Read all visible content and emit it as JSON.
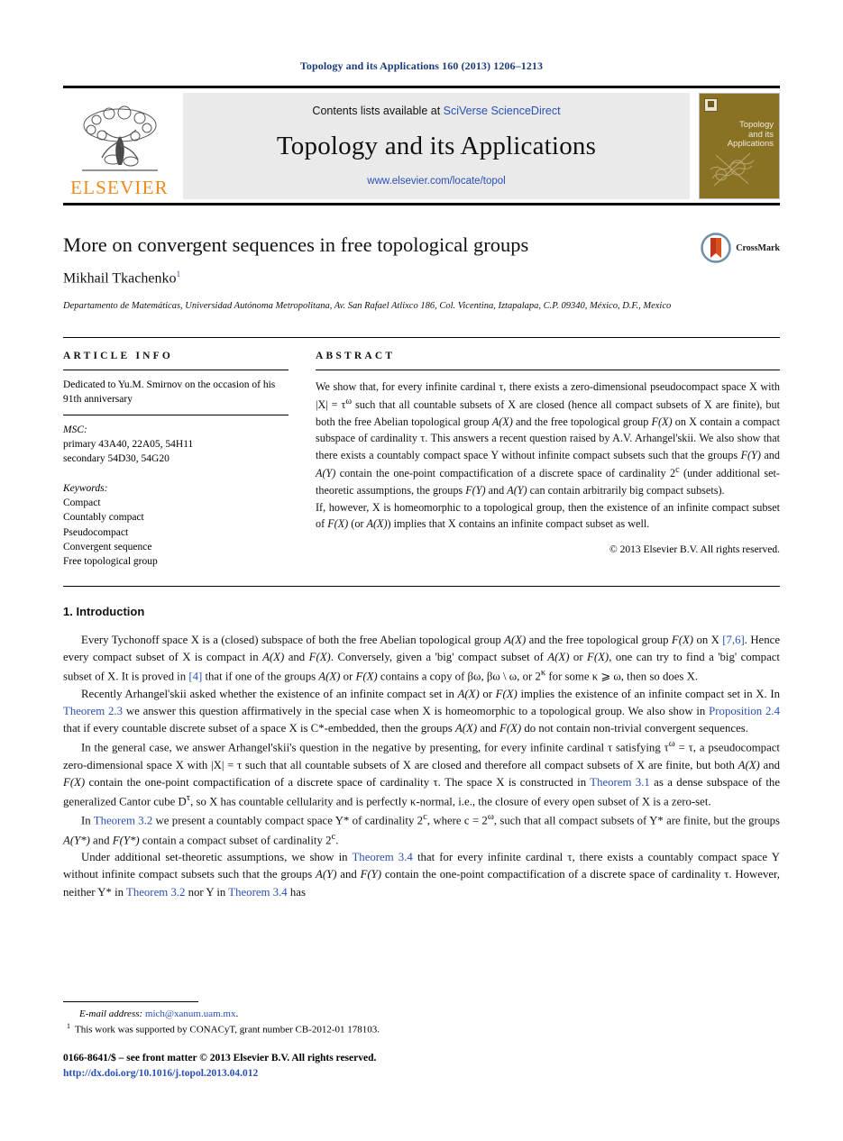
{
  "running_head": "Topology and its Applications 160 (2013) 1206–1213",
  "masthead": {
    "publisher_name": "ELSEVIER",
    "contents_prefix": "Contents lists available at ",
    "sciencedirect_link": "SciVerse ScienceDirect",
    "journal_title": "Topology and its Applications",
    "journal_url": "www.elsevier.com/locate/topol",
    "cover_title_lines": [
      "Topology",
      "and its",
      "Applications"
    ]
  },
  "title_block": {
    "title": "More on convergent sequences in free topological groups",
    "author": "Mikhail Tkachenko",
    "author_footnote_marker": "1",
    "affiliation": "Departamento de Matemáticas, Universidad Autónoma Metropolitana, Av. San Rafael Atlixco 186, Col. Vicentina, Iztapalapa, C.P. 09340, México, D.F., Mexico",
    "crossmark_label": "CrossMark"
  },
  "article_info": {
    "heading": "ARTICLE INFO",
    "dedication": "Dedicated to Yu.M. Smirnov on the occasion of his 91th anniversary",
    "msc_label": "MSC:",
    "msc_lines": [
      "primary 43A40, 22A05, 54H11",
      "secondary 54D30, 54G20"
    ],
    "keywords_label": "Keywords:",
    "keywords": [
      "Compact",
      "Countably compact",
      "Pseudocompact",
      "Convergent sequence",
      "Free topological group"
    ]
  },
  "abstract": {
    "heading": "ABSTRACT",
    "paragraphs": [
      "We show that, for every infinite cardinal τ, there exists a zero-dimensional pseudocompact space X with |X| = τ<sup>ω</sup> such that all countable subsets of X are closed (hence all compact subsets of X are finite), but both the free Abelian topological group A(X) and the free topological group F(X) on X contain a compact subspace of cardinality τ. This answers a recent question raised by A.V. Arhangel'skii. We also show that there exists a countably compact space Y without infinite compact subsets such that the groups F(Y) and A(Y) contain the one-point compactification of a discrete space of cardinality 2<sup>c</sup> (under additional set-theoretic assumptions, the groups F(Y) and A(Y) can contain arbitrarily big compact subsets).",
      "If, however, X is homeomorphic to a topological group, then the existence of an infinite compact subset of F(X) (or A(X)) implies that X contains an infinite compact subset as well."
    ],
    "copyright": "© 2013 Elsevier B.V. All rights reserved."
  },
  "section": {
    "number_title": "1. Introduction",
    "paragraphs": [
      "Every Tychonoff space X is a (closed) subspace of both the free Abelian topological group A(X) and the free topological group F(X) on X [7,6]. Hence every compact subset of X is compact in A(X) and F(X). Conversely, given a 'big' compact subset of A(X) or F(X), one can try to find a 'big' compact subset of X. It is proved in [4] that if one of the groups A(X) or F(X) contains a copy of βω, βω \\ ω, or 2<sup>κ</sup> for some κ ⩾ ω, then so does X.",
      "Recently Arhangel'skii asked whether the existence of an infinite compact set in A(X) or F(X) implies the existence of an infinite compact set in X. In Theorem 2.3 we answer this question affirmatively in the special case when X is homeomorphic to a topological group. We also show in Proposition 2.4 that if every countable discrete subset of a space X is C*-embedded, then the groups A(X) and F(X) do not contain non-trivial convergent sequences.",
      "In the general case, we answer Arhangel'skii's question in the negative by presenting, for every infinite cardinal τ satisfying τ<sup>ω</sup> = τ, a pseudocompact zero-dimensional space X with |X| = τ such that all countable subsets of X are closed and therefore all compact subsets of X are finite, but both A(X) and F(X) contain the one-point compactification of a discrete space of cardinality τ. The space X is constructed in Theorem 3.1 as a dense subspace of the generalized Cantor cube D<sup>τ</sup>, so X has countable cellularity and is perfectly κ-normal, i.e., the closure of every open subset of X is a zero-set.",
      "In Theorem 3.2 we present a countably compact space Y* of cardinality 2<sup>c</sup>, where c = 2<sup>ω</sup>, such that all compact subsets of Y* are finite, but the groups A(Y*) and F(Y*) contain a compact subset of cardinality 2<sup>c</sup>.",
      "Under additional set-theoretic assumptions, we show in Theorem 3.4 that for every infinite cardinal τ, there exists a countably compact space Y without infinite compact subsets such that the groups A(Y) and F(Y) contain the one-point compactification of a discrete space of cardinality τ. However, neither Y* in Theorem 3.2 nor Y in Theorem 3.4 has"
    ]
  },
  "footnotes": {
    "email_label": "E-mail address:",
    "email": "mich@xanum.uam.mx",
    "funding_marker": "1",
    "funding": "This work was supported by CONACyT, grant number CB-2012-01 178103.",
    "front_matter": "0166-8641/$ – see front matter © 2013 Elsevier B.V. All rights reserved.",
    "doi": "http://dx.doi.org/10.1016/j.topol.2013.04.012"
  },
  "colors": {
    "link": "#2a4fb5",
    "running_head": "#1b3a78",
    "elsevier_orange": "#f08a1b",
    "cover_olive": "#8a7224",
    "masthead_grey": "#eaeaea"
  }
}
